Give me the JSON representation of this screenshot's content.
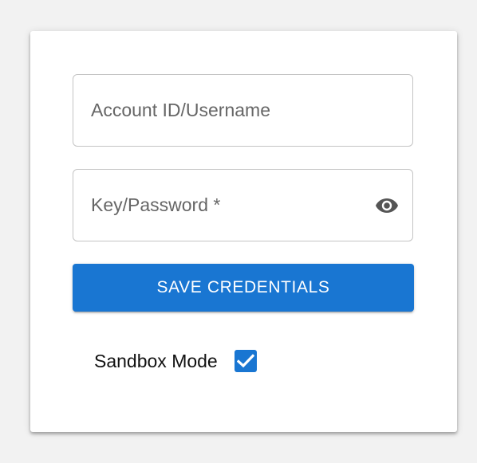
{
  "form": {
    "username": {
      "placeholder": "Account ID/Username",
      "value": ""
    },
    "password": {
      "placeholder": "Key/Password *",
      "value": "",
      "visibility_icon": "eye-icon"
    },
    "save_button": {
      "label": "SAVE CREDENTIALS"
    },
    "sandbox": {
      "label": "Sandbox Mode",
      "checked": true,
      "icon": "checkmark-icon"
    }
  },
  "colors": {
    "accent": "#1976d2",
    "page_background": "#f2f2f2",
    "card_background": "#ffffff",
    "field_border": "#c4c4c4",
    "placeholder_text": "#666666",
    "icon_gray": "#555555"
  }
}
